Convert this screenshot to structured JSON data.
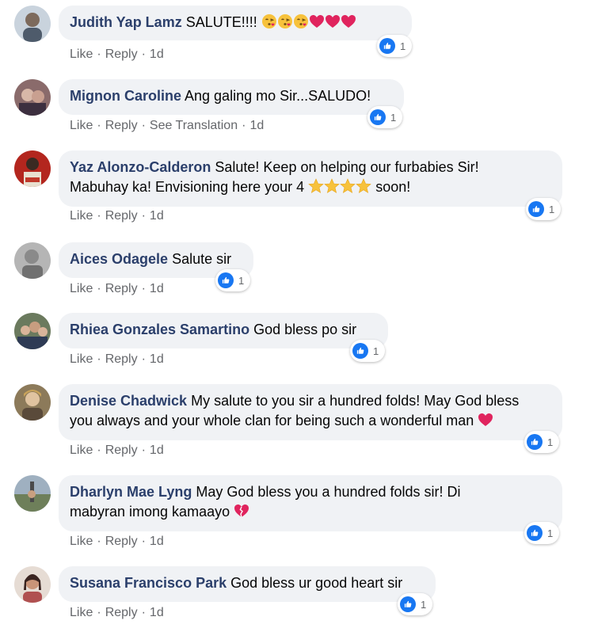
{
  "common": {
    "like_label": "Like",
    "reply_label": "Reply",
    "translate_label": "See Translation",
    "separator": "·"
  },
  "comments": [
    {
      "name": "Judith Yap Lamz",
      "text": "SALUTE!!!!",
      "time": "1d",
      "likes": "1",
      "avatar_color": "#c9d3dd"
    },
    {
      "name": "Mignon Caroline",
      "text": "Ang galing mo Sir...SALUDO!",
      "time": "1d",
      "likes": "1",
      "avatar_color": "#8a6b6b"
    },
    {
      "name": "Yaz Alonzo-Calderon",
      "text": "Salute! Keep on helping our furbabies Sir!",
      "text2": "Mabuhay ka! Envisioning here your 4",
      "text3": "soon!",
      "time": "1d",
      "likes": "1",
      "avatar_color": "#b3261e"
    },
    {
      "name": "Aices Odagele",
      "text": "Salute sir",
      "time": "1d",
      "likes": "1",
      "avatar_color": "#a8a8a8"
    },
    {
      "name": "Rhiea Gonzales Samartino",
      "text": "God bless po sir",
      "time": "1d",
      "likes": "1",
      "avatar_color": "#6b7a5e"
    },
    {
      "name": "Denise Chadwick",
      "text": "My salute to you sir a hundred folds! May God bless",
      "text2": "you always and your whole clan for being such a wonderful man",
      "time": "1d",
      "likes": "1",
      "avatar_color": "#8c7a5a"
    },
    {
      "name": "Dharlyn Mae Lyng",
      "text": "May God bless you a hundred folds sir! Di",
      "text2": "mabyran imong kamaayo",
      "time": "1d",
      "likes": "1",
      "avatar_color": "#7d8a7a"
    },
    {
      "name": "Susana Francisco Park",
      "text": "God bless ur good heart sir",
      "time": "1d",
      "likes": "1",
      "avatar_color": "#b08070"
    }
  ]
}
